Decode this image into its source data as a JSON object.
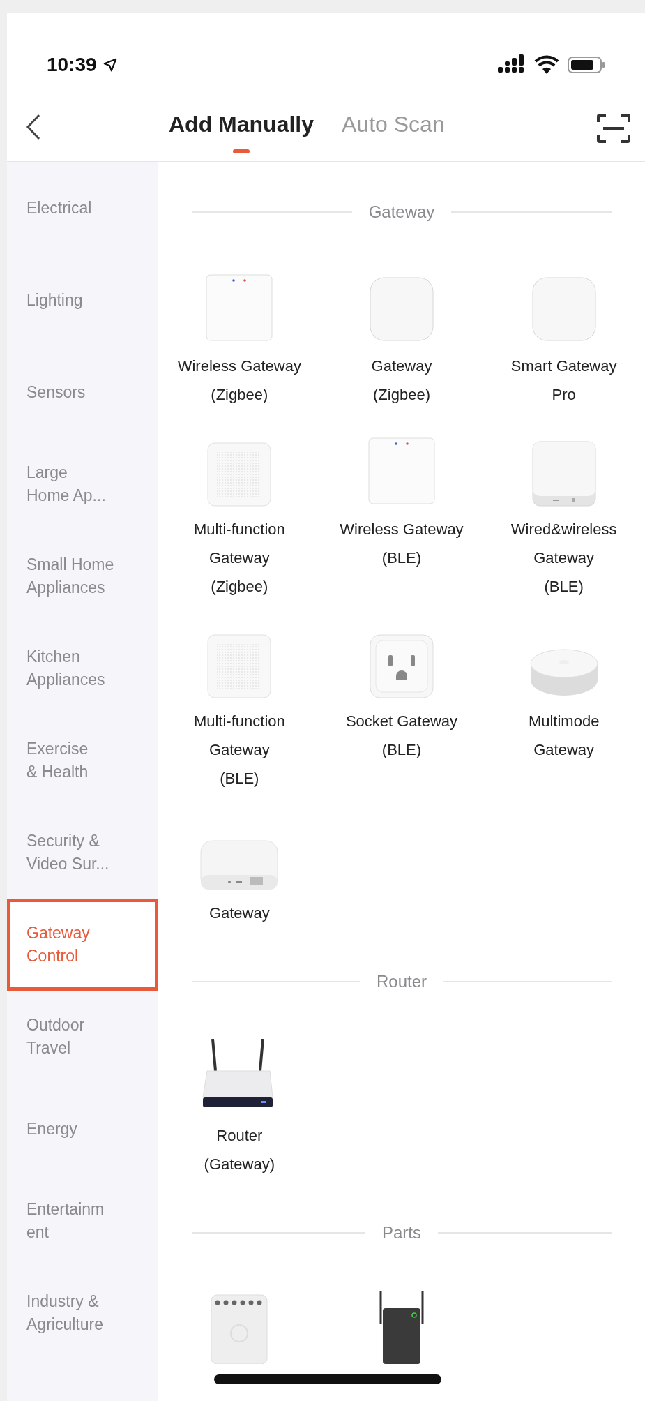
{
  "status_bar": {
    "time": "10:39"
  },
  "header": {
    "tabs": [
      {
        "label": "Add Manually",
        "selected": true
      },
      {
        "label": "Auto Scan",
        "selected": false
      }
    ]
  },
  "sidebar": {
    "items": [
      {
        "lines": [
          "Electrical"
        ],
        "selected": false
      },
      {
        "lines": [
          "Lighting"
        ],
        "selected": false
      },
      {
        "lines": [
          "Sensors"
        ],
        "selected": false
      },
      {
        "lines": [
          "Large",
          "Home Ap..."
        ],
        "selected": false
      },
      {
        "lines": [
          "Small Home",
          "Appliances"
        ],
        "selected": false
      },
      {
        "lines": [
          "Kitchen",
          "Appliances"
        ],
        "selected": false
      },
      {
        "lines": [
          "Exercise",
          "& Health"
        ],
        "selected": false
      },
      {
        "lines": [
          "Security &",
          "Video Sur..."
        ],
        "selected": false
      },
      {
        "lines": [
          "Gateway",
          "Control"
        ],
        "selected": true
      },
      {
        "lines": [
          "Outdoor",
          "Travel"
        ],
        "selected": false
      },
      {
        "lines": [
          "Energy"
        ],
        "selected": false
      },
      {
        "lines": [
          "Entertainm",
          "ent"
        ],
        "selected": false
      },
      {
        "lines": [
          "Industry &",
          "Agriculture"
        ],
        "selected": false
      }
    ]
  },
  "sections": [
    {
      "title": "Gateway",
      "products": [
        {
          "kind": "hub",
          "name_lines": [
            "Wireless Gateway",
            "(Zigbee)"
          ]
        },
        {
          "kind": "pad",
          "name_lines": [
            "Gateway",
            "(Zigbee)"
          ]
        },
        {
          "kind": "pad",
          "name_lines": [
            "Smart Gateway",
            "Pro"
          ]
        },
        {
          "kind": "speaker",
          "name_lines": [
            "Multi-function",
            "Gateway",
            "(Zigbee)"
          ]
        },
        {
          "kind": "hub",
          "name_lines": [
            "Wireless Gateway",
            "(BLE)"
          ]
        },
        {
          "kind": "base",
          "name_lines": [
            "Wired&wireless",
            "Gateway",
            "(BLE)"
          ]
        },
        {
          "kind": "speaker",
          "name_lines": [
            "Multi-function",
            "Gateway",
            "(BLE)"
          ]
        },
        {
          "kind": "socket",
          "name_lines": [
            "Socket Gateway",
            "(BLE)"
          ]
        },
        {
          "kind": "puck",
          "name_lines": [
            "Multimode",
            "Gateway"
          ]
        },
        {
          "kind": "flat",
          "name_lines": [
            "Gateway"
          ]
        }
      ]
    },
    {
      "title": "Router",
      "products": [
        {
          "kind": "router",
          "name_lines": [
            "Router",
            "(Gateway)"
          ]
        }
      ]
    },
    {
      "title": "Parts",
      "products": [
        {
          "kind": "relay"
        },
        {
          "kind": "extender"
        }
      ]
    }
  ]
}
